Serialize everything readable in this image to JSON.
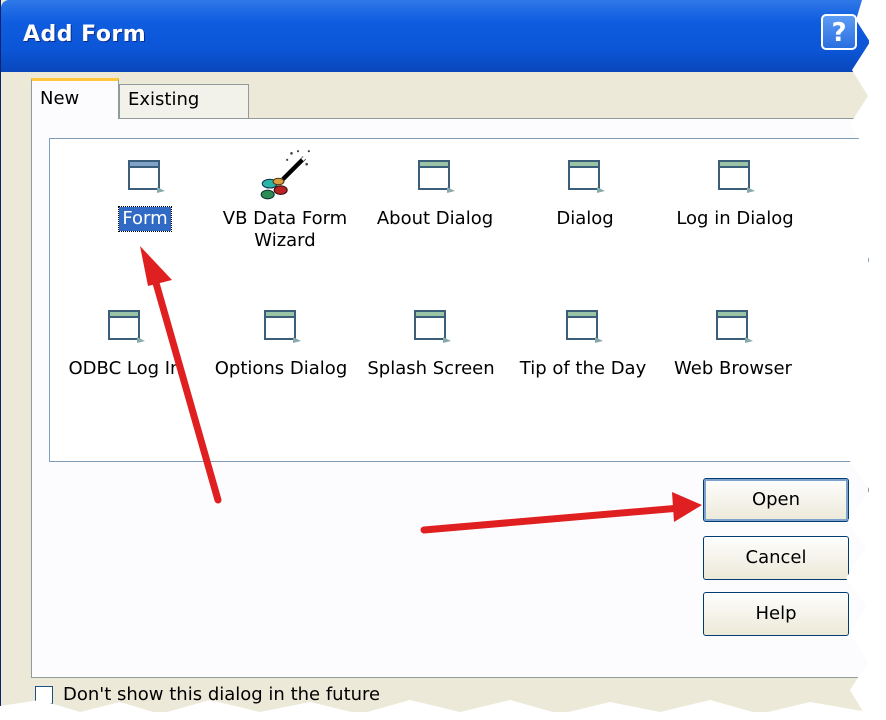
{
  "window": {
    "title": "Add Form",
    "help_glyph": "?"
  },
  "tabs": [
    {
      "label": "New",
      "active": true
    },
    {
      "label": "Existing",
      "active": false
    }
  ],
  "items": [
    {
      "label": "Form",
      "icon": "form-icon",
      "selected": true
    },
    {
      "label": "VB Data Form Wizard",
      "icon": "wizard-icon",
      "selected": false
    },
    {
      "label": "About Dialog",
      "icon": "form-icon",
      "selected": false
    },
    {
      "label": "Dialog",
      "icon": "form-icon",
      "selected": false
    },
    {
      "label": "Log in Dialog",
      "icon": "form-icon",
      "selected": false
    },
    {
      "label": "ODBC Log In",
      "icon": "form-icon",
      "selected": false
    },
    {
      "label": "Options Dialog",
      "icon": "form-icon",
      "selected": false
    },
    {
      "label": "Splash Screen",
      "icon": "form-icon",
      "selected": false
    },
    {
      "label": "Tip of the Day",
      "icon": "form-icon",
      "selected": false
    },
    {
      "label": "Web Browser",
      "icon": "form-icon",
      "selected": false
    }
  ],
  "buttons": {
    "open": "Open",
    "cancel": "Cancel",
    "help": "Help"
  },
  "checkbox": {
    "label": "Don't show this dialog in the future",
    "checked": false
  },
  "colors": {
    "titlebar": "#0b55d6",
    "selection": "#316ac5",
    "annotation_arrow": "#e02020"
  }
}
